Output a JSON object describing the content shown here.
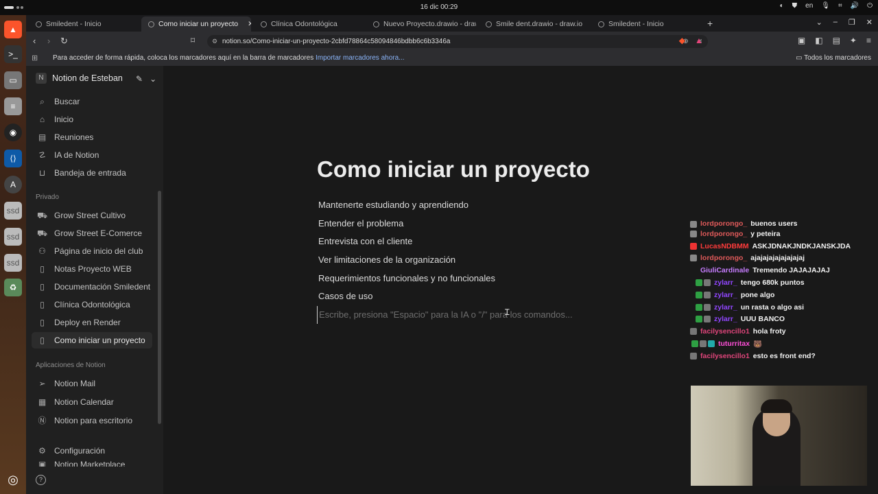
{
  "system": {
    "clock": "16 dic  00:29",
    "language": "en"
  },
  "tabs": [
    {
      "label": "Smiledent - Inicio",
      "active": false
    },
    {
      "label": "Como iniciar un proyecto",
      "active": true
    },
    {
      "label": "Clínica Odontológica",
      "active": false
    },
    {
      "label": "Nuevo Proyecto.drawio - draw",
      "active": false
    },
    {
      "label": "Smile dent.drawio - draw.io",
      "active": false
    },
    {
      "label": "Smiledent - Inicio",
      "active": false
    }
  ],
  "address": {
    "url": "notion.so/Como-iniciar-un-proyecto-2cbfd78864c58094846bdbb6c6b3346a"
  },
  "bookmarks": {
    "hint": "Para acceder de forma rápida, coloca los marcadores aquí en la barra de marcadores",
    "import_link": "Importar marcadores ahora...",
    "all_bookmarks": "Todos los marcadores"
  },
  "sidebar": {
    "workspace_initial": "N",
    "workspace": "Notion de Esteban",
    "top_items": [
      {
        "label": "Buscar",
        "icon": "search-icon"
      },
      {
        "label": "Inicio",
        "icon": "home-icon"
      },
      {
        "label": "Reuniones",
        "icon": "meetings-icon"
      },
      {
        "label": "IA de Notion",
        "icon": "ai-icon"
      },
      {
        "label": "Bandeja de entrada",
        "icon": "inbox-icon"
      }
    ],
    "private_title": "Privado",
    "private_items": [
      {
        "label": "Grow Street Cultivo",
        "icon": "car-icon"
      },
      {
        "label": "Grow Street E-Comerce",
        "icon": "car-icon"
      },
      {
        "label": "Página de inicio del club",
        "icon": "people-icon"
      },
      {
        "label": "Notas Proyecto WEB",
        "icon": "page-icon"
      },
      {
        "label": "Documentación Smiledent",
        "icon": "page-icon"
      },
      {
        "label": "Clínica Odontológica",
        "icon": "page-icon"
      },
      {
        "label": "Deploy en Render",
        "icon": "page-icon"
      },
      {
        "label": "Como iniciar un proyecto",
        "icon": "page-icon"
      }
    ],
    "apps_title": "Aplicaciones de Notion",
    "app_items": [
      {
        "label": "Notion Mail",
        "icon": "send-icon"
      },
      {
        "label": "Notion Calendar",
        "icon": "calendar-icon"
      },
      {
        "label": "Notion para escritorio",
        "icon": "notion-icon"
      }
    ],
    "settings": "Configuración",
    "marketplace": "Notion Marketplace"
  },
  "page": {
    "title": "Como iniciar un proyecto",
    "blocks": [
      "Mantenerte estudiando y aprendiendo",
      "Entender el problema",
      "Entrevista con el cliente",
      "Ver limitaciones de la organización",
      "Requerimientos funcionales y no funcionales",
      "Casos de uso"
    ],
    "placeholder": "Escribe, presiona \"Espacio\" para la IA o \"/\" para los comandos..."
  },
  "chat": [
    {
      "user": "lordporongo_",
      "color": "#e05a5a",
      "message": "buenos users"
    },
    {
      "user": "lordporongo_",
      "color": "#e05a5a",
      "message": "y peteira"
    },
    {
      "user": "LucasNDBMM",
      "color": "#ff3b3b",
      "message": "ASKJDNAKJNDKJANSKJDA"
    },
    {
      "user": "lordporongo_",
      "color": "#e05a5a",
      "message": "ajajajajajajajajaj"
    },
    {
      "user": "GiuliCardinale",
      "color": "#c77dff",
      "message": "Tremendo JAJAJAJAJ"
    },
    {
      "user": "zylarr_",
      "color": "#9146ff",
      "message": "tengo 680k puntos"
    },
    {
      "user": "zylarr_",
      "color": "#9146ff",
      "message": "pone algo"
    },
    {
      "user": "zylarr_",
      "color": "#9146ff",
      "message": "un rasta o algo asi"
    },
    {
      "user": "zylarr_",
      "color": "#9146ff",
      "message": "UUU BANCO"
    },
    {
      "user": "facilysencillo1",
      "color": "#e0457b",
      "message": "hola froty"
    },
    {
      "user": "tuturritax",
      "color": "#ff4fd8",
      "message": "🐻"
    },
    {
      "user": "facilysencillo1",
      "color": "#e0457b",
      "message": "esto es front end?"
    }
  ],
  "colors": {
    "background": "#191919",
    "sidebar": "#202020",
    "accent_link": "#8ab4f8"
  }
}
